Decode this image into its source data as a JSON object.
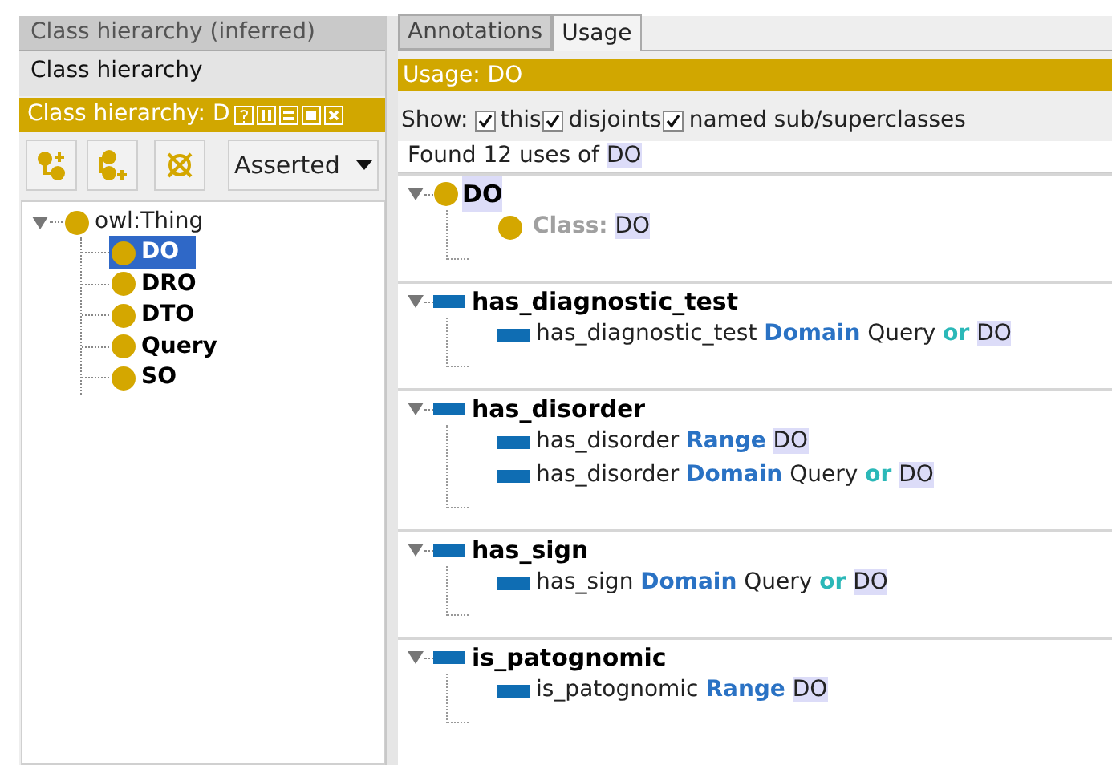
{
  "left_panel": {
    "tabs": [
      {
        "label": "Class hierarchy (inferred)",
        "selected": false
      },
      {
        "label": "Class hierarchy",
        "selected": true
      }
    ],
    "view_header": {
      "title": "Class hierarchy: D"
    },
    "dropdown": {
      "value": "Asserted"
    },
    "tree": {
      "label": "owl:Thing",
      "expanded": true,
      "children": [
        {
          "label": "DO",
          "selected": true
        },
        {
          "label": "DRO",
          "selected": false
        },
        {
          "label": "DTO",
          "selected": false
        },
        {
          "label": "Query",
          "selected": false
        },
        {
          "label": "SO",
          "selected": false
        }
      ]
    }
  },
  "right_panel": {
    "tabs": [
      {
        "label": "Annotations",
        "selected": false
      },
      {
        "label": "Usage",
        "selected": true
      }
    ],
    "view_header": {
      "title": "Usage: DO"
    },
    "show": {
      "label": "Show:",
      "options": [
        {
          "label": "this",
          "checked": true
        },
        {
          "label": "disjoints",
          "checked": true
        },
        {
          "label": "named sub/superclasses",
          "checked": true
        }
      ]
    },
    "found": {
      "text": "Found 12 uses of ",
      "entity": "DO"
    },
    "groups": [
      {
        "kind": "class",
        "label": "DO",
        "expanded": true,
        "items": [
          {
            "kind": "class",
            "parts": [
              {
                "kind": "label",
                "text": "Class:"
              },
              {
                "kind": "entity",
                "text": "DO"
              }
            ]
          }
        ]
      },
      {
        "kind": "property",
        "label": "has_diagnostic_test",
        "expanded": true,
        "items": [
          {
            "kind": "property",
            "parts": [
              {
                "kind": "plain",
                "text": "has_diagnostic_test"
              },
              {
                "kind": "keyword",
                "text": "Domain"
              },
              {
                "kind": "plain",
                "text": "Query"
              },
              {
                "kind": "operator",
                "text": "or"
              },
              {
                "kind": "entity",
                "text": "DO"
              }
            ]
          }
        ]
      },
      {
        "kind": "property",
        "label": "has_disorder",
        "expanded": true,
        "items": [
          {
            "kind": "property",
            "parts": [
              {
                "kind": "plain",
                "text": "has_disorder"
              },
              {
                "kind": "keyword",
                "text": "Range"
              },
              {
                "kind": "entity",
                "text": "DO"
              }
            ]
          },
          {
            "kind": "property",
            "parts": [
              {
                "kind": "plain",
                "text": "has_disorder"
              },
              {
                "kind": "keyword",
                "text": "Domain"
              },
              {
                "kind": "plain",
                "text": "Query"
              },
              {
                "kind": "operator",
                "text": "or"
              },
              {
                "kind": "entity",
                "text": "DO"
              }
            ]
          }
        ]
      },
      {
        "kind": "property",
        "label": "has_sign",
        "expanded": true,
        "items": [
          {
            "kind": "property",
            "parts": [
              {
                "kind": "plain",
                "text": "has_sign"
              },
              {
                "kind": "keyword",
                "text": "Domain"
              },
              {
                "kind": "plain",
                "text": "Query"
              },
              {
                "kind": "operator",
                "text": "or"
              },
              {
                "kind": "entity",
                "text": "DO"
              }
            ]
          }
        ]
      },
      {
        "kind": "property",
        "label": "is_patognomic",
        "expanded": true,
        "items": [
          {
            "kind": "property",
            "parts": [
              {
                "kind": "plain",
                "text": "is_patognomic"
              },
              {
                "kind": "keyword",
                "text": "Range"
              },
              {
                "kind": "entity",
                "text": "DO"
              }
            ]
          }
        ]
      }
    ]
  }
}
